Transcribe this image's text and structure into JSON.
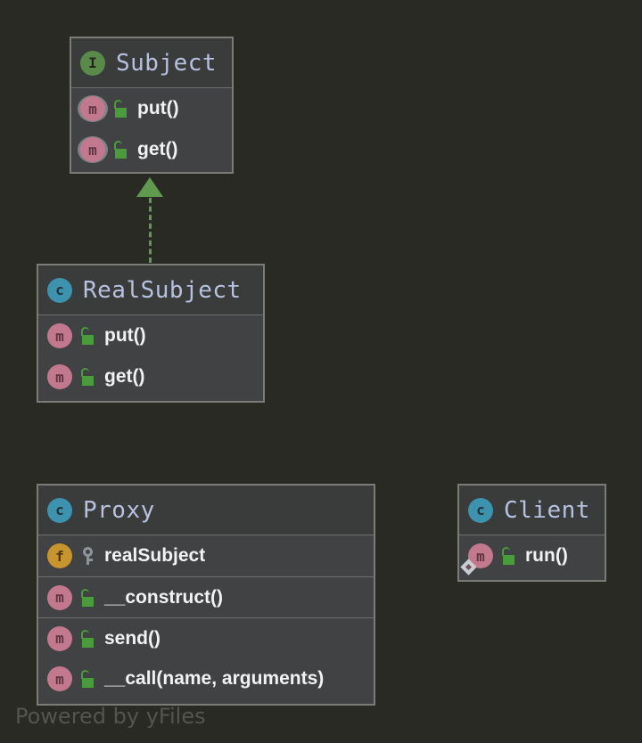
{
  "diagram": {
    "type": "uml-class-diagram",
    "background_color": "#2a2a25",
    "watermark": "Powered by yFiles",
    "accent_colors": {
      "interface": "#5a8a4a",
      "class": "#3d93ae",
      "method": "#c2798d",
      "field": "#c8942e",
      "public_lock": "#4a9b3c",
      "private_key": "#8d949a",
      "edge": "#5f9a4f",
      "title_text": "#b6c2df",
      "member_text": "#f2f2f2",
      "node_header": "#3a3b3b",
      "node_body": "#414244",
      "node_border": "#7b7b78"
    }
  },
  "nodes": [
    {
      "id": "subject",
      "name": "Subject",
      "stereotype": "interface",
      "badge_letter": "I",
      "members": [
        {
          "name": "put()",
          "kind": "method",
          "badge_letter": "m",
          "visibility": "public",
          "abstract": true,
          "marker": "none"
        },
        {
          "name": "get()",
          "kind": "method",
          "badge_letter": "m",
          "visibility": "public",
          "abstract": true,
          "marker": "none"
        }
      ]
    },
    {
      "id": "realsubject",
      "name": "RealSubject",
      "stereotype": "class",
      "badge_letter": "c",
      "members": [
        {
          "name": "put()",
          "kind": "method",
          "badge_letter": "m",
          "visibility": "public",
          "abstract": false,
          "marker": "none"
        },
        {
          "name": "get()",
          "kind": "method",
          "badge_letter": "m",
          "visibility": "public",
          "abstract": false,
          "marker": "none"
        }
      ]
    },
    {
      "id": "proxy",
      "name": "Proxy",
      "stereotype": "class",
      "badge_letter": "c",
      "members": [
        {
          "name": "realSubject",
          "kind": "field",
          "badge_letter": "f",
          "visibility": "private",
          "abstract": false,
          "marker": "none"
        },
        {
          "name": "__construct()",
          "kind": "method",
          "badge_letter": "m",
          "visibility": "public",
          "abstract": false,
          "marker": "none"
        },
        {
          "name": "send()",
          "kind": "method",
          "badge_letter": "m",
          "visibility": "public",
          "abstract": false,
          "marker": "none"
        },
        {
          "name": "__call(name, arguments)",
          "kind": "method",
          "badge_letter": "m",
          "visibility": "public",
          "abstract": false,
          "marker": "none"
        }
      ]
    },
    {
      "id": "client",
      "name": "Client",
      "stereotype": "class",
      "badge_letter": "c",
      "members": [
        {
          "name": "run()",
          "kind": "method",
          "badge_letter": "m",
          "visibility": "public",
          "abstract": false,
          "marker": "diamond"
        }
      ]
    }
  ],
  "edges": [
    {
      "id": "realsubject-implements-subject",
      "source": "RealSubject",
      "target": "Subject",
      "relation": "realization",
      "line_style": "dashed",
      "arrow_head": "triangle",
      "color": "#5f9a4f"
    }
  ]
}
